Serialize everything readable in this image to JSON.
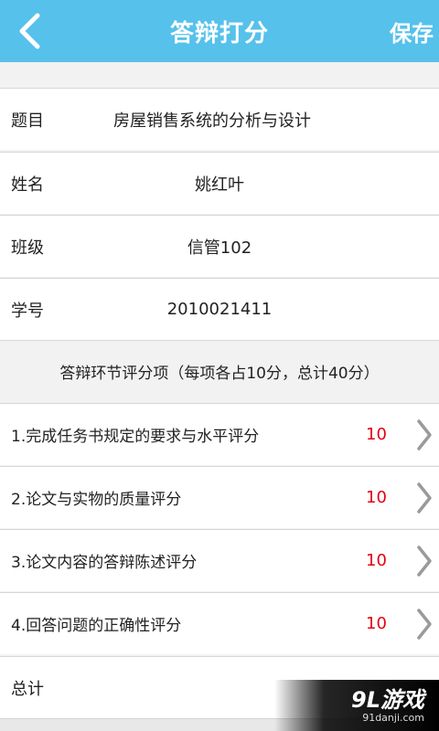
{
  "header": {
    "title": "答辩打分",
    "back_icon": "chevron-left-icon",
    "save_label": "保存",
    "color": "#56c1eb"
  },
  "info": {
    "topic": {
      "label": "题目",
      "value": "房屋销售系统的分析与设计"
    },
    "name": {
      "label": "姓名",
      "value": "姚红叶"
    },
    "class": {
      "label": "班级",
      "value": "信管102"
    },
    "student_id": {
      "label": "学号",
      "value": "2010021411"
    }
  },
  "section": {
    "title": "答辩环节评分项（每项各占10分，总计40分）"
  },
  "scores": [
    {
      "label": "1.完成任务书规定的要求与水平评分",
      "score": "10"
    },
    {
      "label": "2.论文与实物的质量评分",
      "score": "10"
    },
    {
      "label": "3.论文内容的答辩陈述评分",
      "score": "10"
    },
    {
      "label": "4.回答问题的正确性评分",
      "score": "10"
    }
  ],
  "total": {
    "label": "总计"
  },
  "score_color": "#e60012",
  "watermark": {
    "logo": "9L游戏",
    "url": "91danji.com"
  }
}
